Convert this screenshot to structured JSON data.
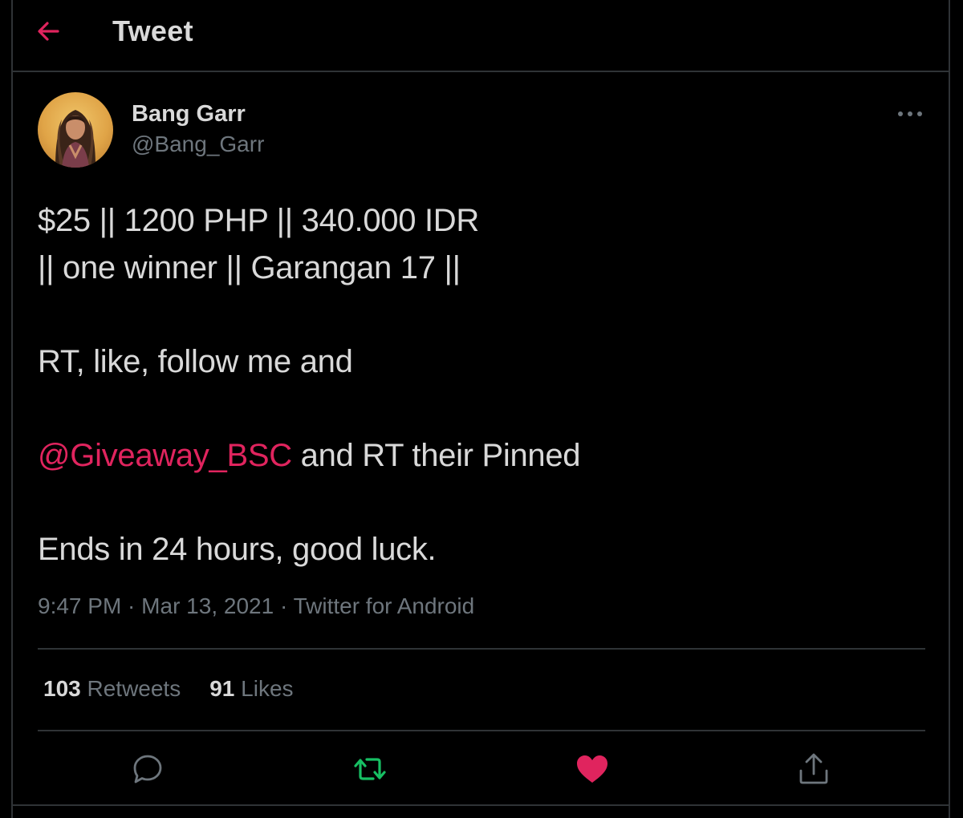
{
  "header": {
    "title": "Tweet"
  },
  "tweet": {
    "author": {
      "display_name": "Bang Garr",
      "handle": "@Bang_Garr"
    },
    "text_lines": [
      "$25 || 1200 PHP || 340.000 IDR",
      "|| one winner || Garangan 17 ||",
      "",
      "RT, like, follow me and",
      "",
      "",
      "",
      "Ends in 24 hours, good luck."
    ],
    "mention_line": {
      "mention": "@Giveaway_BSC",
      "rest": " and RT their Pinned"
    },
    "time": "9:47 PM",
    "date": "Mar 13, 2021",
    "source": "Twitter for Android",
    "separator": " · "
  },
  "stats": {
    "retweets_count": "103",
    "retweets_label": " Retweets",
    "likes_count": "91",
    "likes_label": " Likes"
  },
  "actions": {
    "reply_icon": "reply-icon",
    "retweet_icon": "retweet-icon",
    "like_icon": "heart-icon",
    "share_icon": "share-icon"
  },
  "colors": {
    "background": "#000000",
    "text": "#d9d9d9",
    "secondary_text": "#6e767d",
    "accent": "#e0245e",
    "retweet": "#17bf63",
    "border": "#2f3336"
  }
}
